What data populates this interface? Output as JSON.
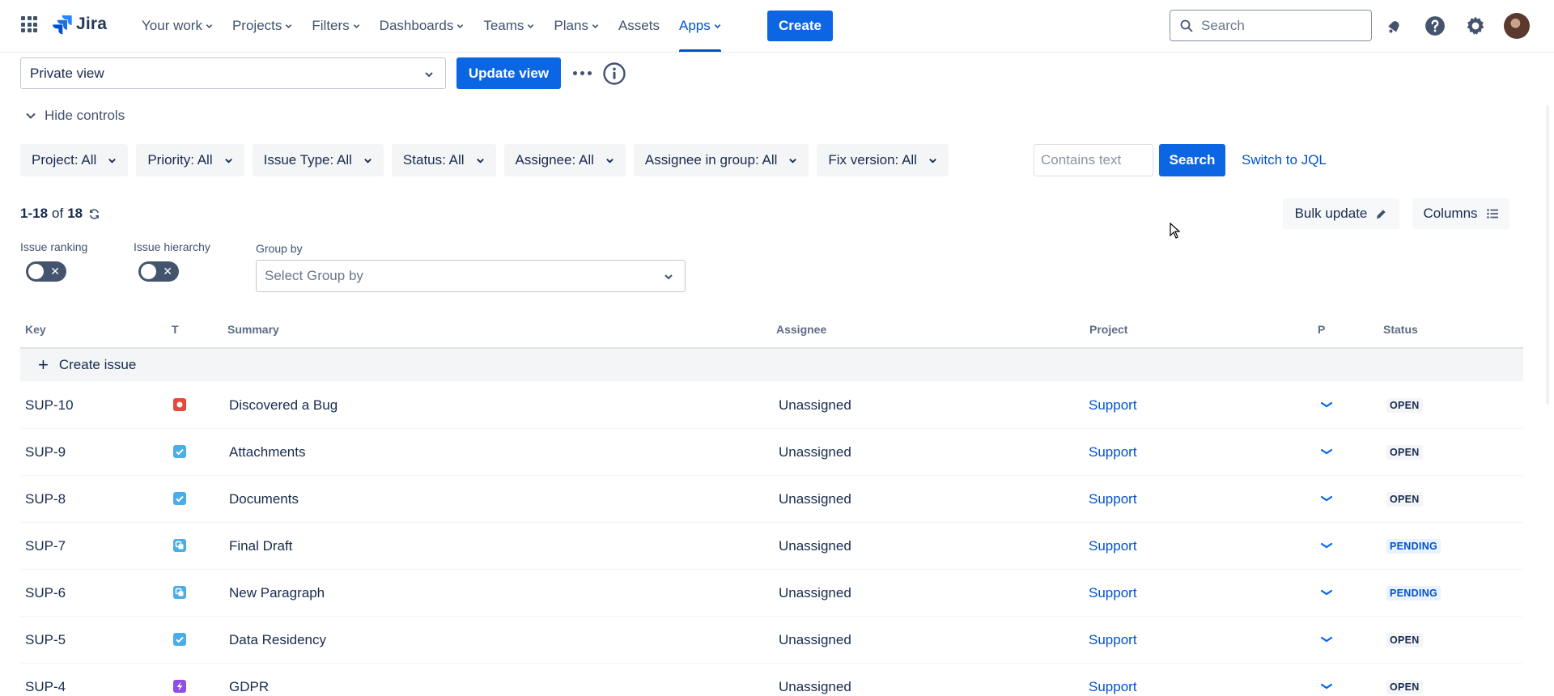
{
  "nav": {
    "logo_text": "Jira",
    "items": [
      {
        "label": "Your work",
        "has_chevron": true
      },
      {
        "label": "Projects",
        "has_chevron": true
      },
      {
        "label": "Filters",
        "has_chevron": true
      },
      {
        "label": "Dashboards",
        "has_chevron": true
      },
      {
        "label": "Teams",
        "has_chevron": true
      },
      {
        "label": "Plans",
        "has_chevron": true
      },
      {
        "label": "Assets",
        "has_chevron": false
      },
      {
        "label": "Apps",
        "has_chevron": true,
        "active": true
      }
    ],
    "create_label": "Create",
    "search_placeholder": "Search",
    "icons": [
      "app-switcher-icon",
      "notifications-icon",
      "help-icon",
      "settings-icon",
      "avatar"
    ]
  },
  "view": {
    "selected": "Private view",
    "update_label": "Update view"
  },
  "controls": {
    "hide_label": "Hide controls",
    "filters": [
      "Project: All",
      "Priority: All",
      "Issue Type: All",
      "Status: All",
      "Assignee: All",
      "Assignee in group: All",
      "Fix version: All"
    ],
    "text_placeholder": "Contains text",
    "search_label": "Search",
    "jql_label": "Switch to JQL"
  },
  "results": {
    "range": "1-18",
    "of_label": "of",
    "total": "18",
    "bulk_label": "Bulk update",
    "columns_label": "Columns"
  },
  "toggles": {
    "ranking_label": "Issue ranking",
    "ranking_on": false,
    "hierarchy_label": "Issue hierarchy",
    "hierarchy_on": false,
    "toggle_off_glyph": "✕"
  },
  "groupby": {
    "label": "Group by",
    "placeholder": "Select Group by"
  },
  "table": {
    "headers": {
      "key": "Key",
      "type": "T",
      "summary": "Summary",
      "assignee": "Assignee",
      "project": "Project",
      "priority": "P",
      "status": "Status"
    },
    "create_label": "Create issue",
    "rows": [
      {
        "key": "SUP-10",
        "type": "bug",
        "summary": "Discovered a Bug",
        "assignee": "Unassigned",
        "project": "Support",
        "priority": "low",
        "status": "OPEN"
      },
      {
        "key": "SUP-9",
        "type": "task",
        "summary": "Attachments",
        "assignee": "Unassigned",
        "project": "Support",
        "priority": "low",
        "status": "OPEN"
      },
      {
        "key": "SUP-8",
        "type": "task",
        "summary": "Documents",
        "assignee": "Unassigned",
        "project": "Support",
        "priority": "low",
        "status": "OPEN"
      },
      {
        "key": "SUP-7",
        "type": "subtask",
        "summary": "Final Draft",
        "assignee": "Unassigned",
        "project": "Support",
        "priority": "low",
        "status": "PENDING"
      },
      {
        "key": "SUP-6",
        "type": "subtask",
        "summary": "New Paragraph",
        "assignee": "Unassigned",
        "project": "Support",
        "priority": "low",
        "status": "PENDING"
      },
      {
        "key": "SUP-5",
        "type": "task",
        "summary": "Data Residency",
        "assignee": "Unassigned",
        "project": "Support",
        "priority": "low",
        "status": "OPEN"
      },
      {
        "key": "SUP-4",
        "type": "epic",
        "summary": "GDPR",
        "assignee": "Unassigned",
        "project": "Support",
        "priority": "low",
        "status": "OPEN"
      }
    ]
  },
  "colors": {
    "brand_blue": "#0c66e4",
    "link_blue": "#0052cc",
    "text": "#172b4d",
    "bug_red": "#e5493a",
    "task_blue": "#4bade8",
    "epic_purple": "#904ee2",
    "pending_text": "#0052cc"
  }
}
